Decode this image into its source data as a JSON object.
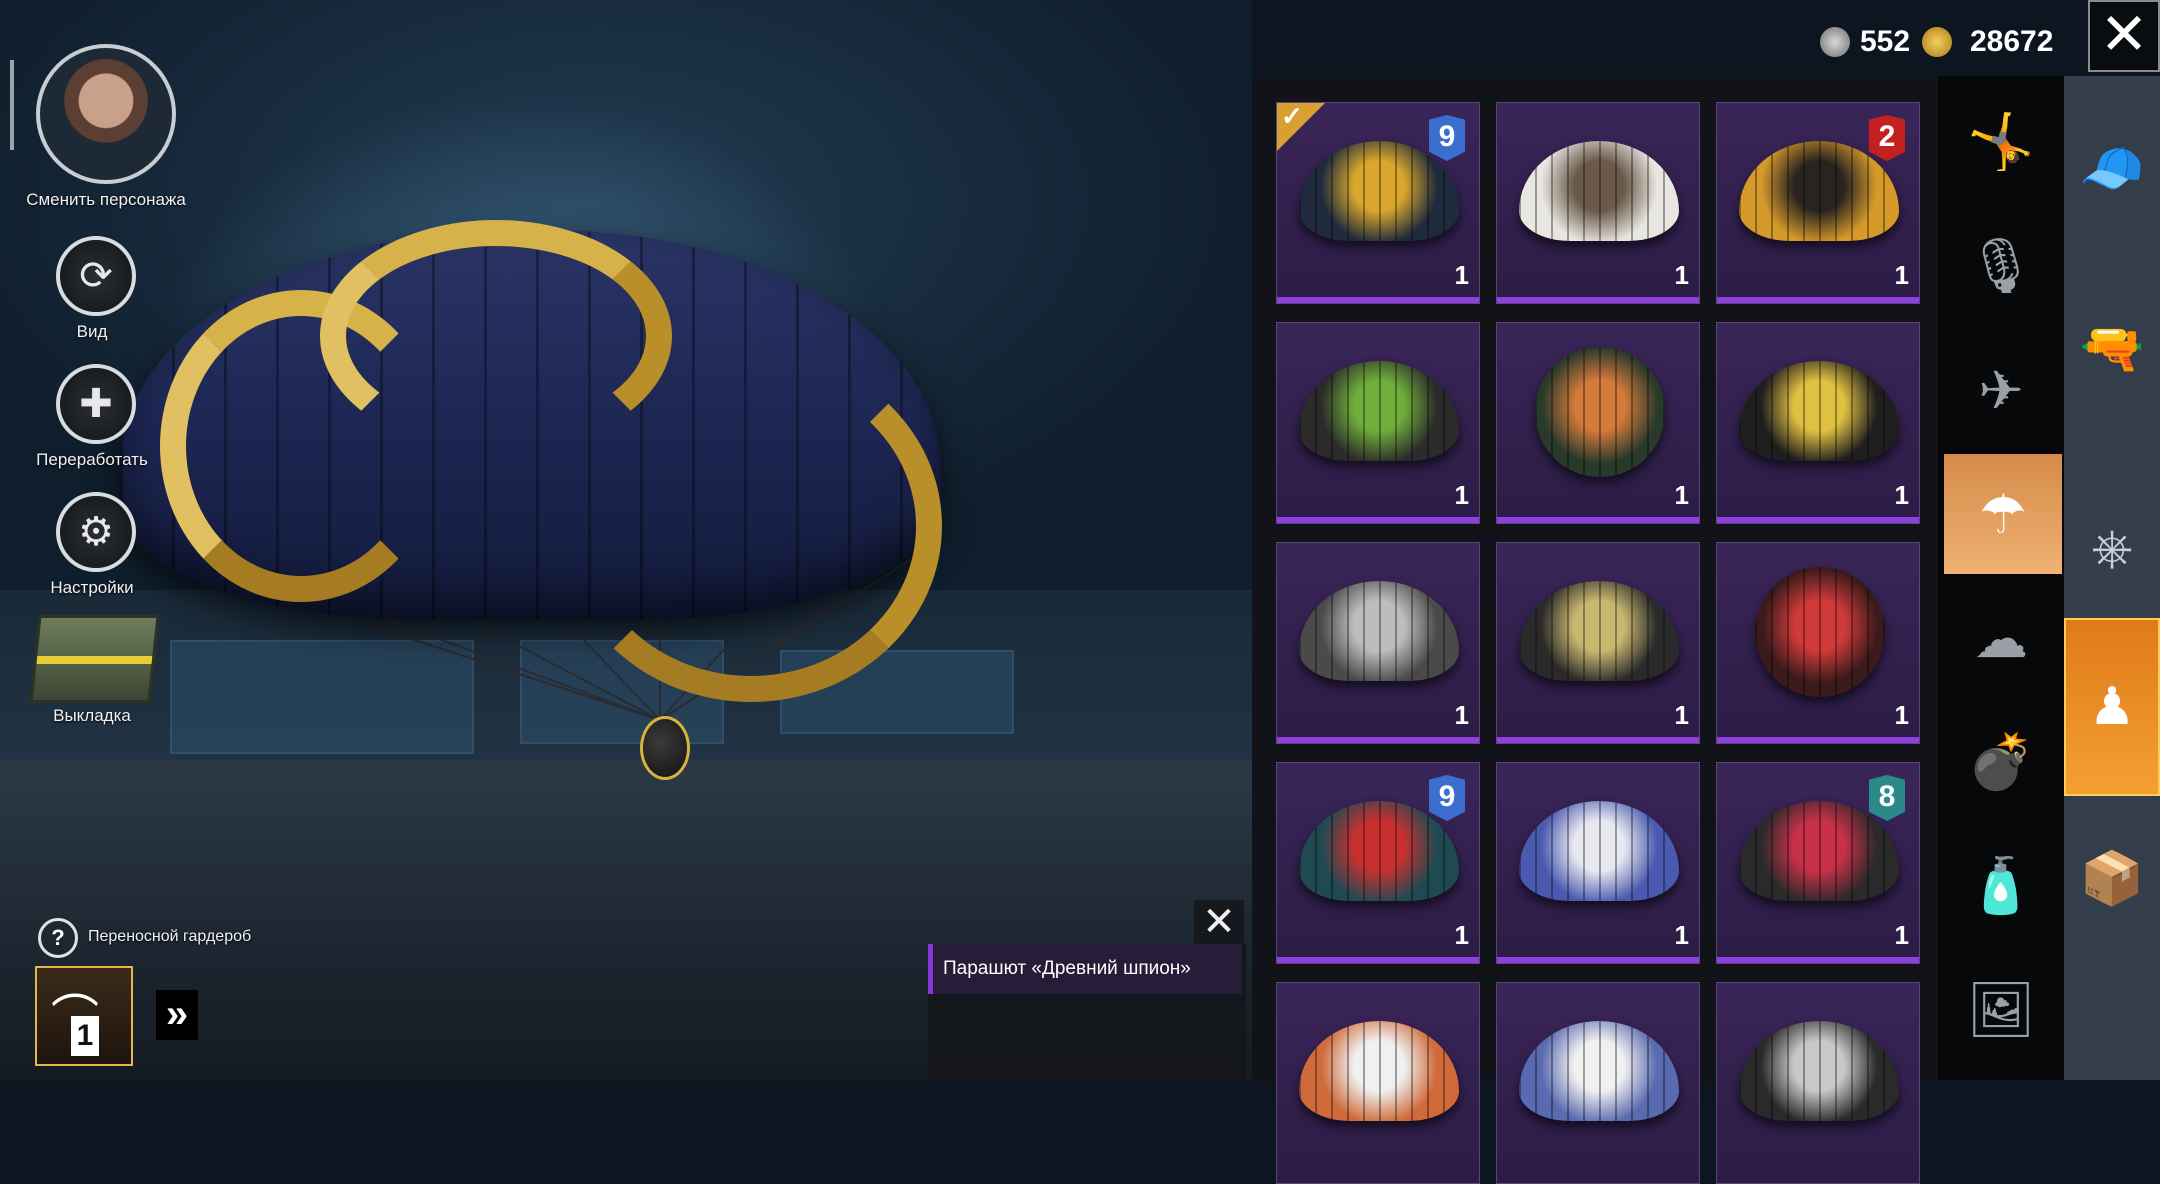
{
  "left_menu": {
    "change_character": "Сменить персонажа",
    "view": "Вид",
    "rework": "Переработать",
    "settings": "Настройки",
    "loadout": "Выкладка",
    "portable_wardrobe": "Переносной гардероб",
    "wardrobe_count": "1",
    "icons": {
      "view": "rotate-icon",
      "rework": "puzzle-icon",
      "settings": "gear-icon",
      "help": "question-icon",
      "wardrobe": "hanger-icon",
      "expand": "double-chevron-right-icon"
    }
  },
  "currency": {
    "silver_value": "552",
    "gold_value": "28672"
  },
  "item_info": {
    "title": "Парашют «Древний шпион»"
  },
  "grid": {
    "items": [
      {
        "qty": "1",
        "level": "9",
        "badge_color": "#3a6fd0",
        "selected": true,
        "colors": [
          "#1f2a3c",
          "#d9a72c"
        ]
      },
      {
        "qty": "1",
        "level": "",
        "badge_color": "",
        "selected": false,
        "colors": [
          "#e8e6e1",
          "#6b5a4a"
        ]
      },
      {
        "qty": "1",
        "level": "2",
        "badge_color": "#c42020",
        "selected": false,
        "colors": [
          "#d69a2a",
          "#2a2420"
        ]
      },
      {
        "qty": "1",
        "level": "",
        "badge_color": "",
        "selected": false,
        "colors": [
          "#2b2b2b",
          "#6fae3a"
        ]
      },
      {
        "qty": "1",
        "level": "",
        "badge_color": "",
        "selected": false,
        "colors": [
          "#2a3a2a",
          "#d47a3a"
        ]
      },
      {
        "qty": "1",
        "level": "",
        "badge_color": "",
        "selected": false,
        "colors": [
          "#1e1e1e",
          "#e0c040"
        ]
      },
      {
        "qty": "1",
        "level": "",
        "badge_color": "",
        "selected": false,
        "colors": [
          "#4a4a4a",
          "#bdbdbd"
        ]
      },
      {
        "qty": "1",
        "level": "",
        "badge_color": "",
        "selected": false,
        "colors": [
          "#2a2a2a",
          "#c9b870"
        ]
      },
      {
        "qty": "1",
        "level": "",
        "badge_color": "",
        "selected": false,
        "colors": [
          "#3a1a1a",
          "#d03a3a"
        ]
      },
      {
        "qty": "1",
        "level": "9",
        "badge_color": "#3a6fd0",
        "selected": false,
        "colors": [
          "#1f4a52",
          "#c83030"
        ]
      },
      {
        "qty": "1",
        "level": "",
        "badge_color": "",
        "selected": false,
        "colors": [
          "#4a5ab0",
          "#e8e8f0"
        ]
      },
      {
        "qty": "1",
        "level": "8",
        "badge_color": "#2a8a8a",
        "selected": false,
        "colors": [
          "#2a2a2a",
          "#c83048"
        ]
      },
      {
        "qty": "",
        "level": "",
        "badge_color": "",
        "selected": false,
        "colors": [
          "#d06a3a",
          "#f0f0f0"
        ]
      },
      {
        "qty": "",
        "level": "",
        "badge_color": "",
        "selected": false,
        "colors": [
          "#5a6ab0",
          "#f0f0f0"
        ]
      },
      {
        "qty": "",
        "level": "",
        "badge_color": "",
        "selected": false,
        "colors": [
          "#2a2a2a",
          "#c8c8c8"
        ]
      }
    ]
  },
  "categories": [
    {
      "icon": "emote-icon",
      "active": false,
      "glyph": "🤸"
    },
    {
      "icon": "microphone-icon",
      "active": false,
      "glyph": "🎙"
    },
    {
      "icon": "plane-icon",
      "active": false,
      "glyph": "✈"
    },
    {
      "icon": "parachute-icon",
      "active": true,
      "glyph": "☂"
    },
    {
      "icon": "smoke-icon",
      "active": false,
      "glyph": "☁"
    },
    {
      "icon": "grenade-icon",
      "active": false,
      "glyph": "💣"
    },
    {
      "icon": "spray-icon",
      "active": false,
      "glyph": "🧴"
    },
    {
      "icon": "gallery-icon",
      "active": false,
      "glyph": "🖼"
    }
  ],
  "types": [
    {
      "icon": "outfit-icon",
      "active": false,
      "glyph": "🧢"
    },
    {
      "icon": "pistol-icon",
      "active": false,
      "glyph": "🔫"
    },
    {
      "icon": "steering-wheel-icon",
      "active": false,
      "glyph": "⎈"
    },
    {
      "icon": "emote-figure-icon",
      "active": true,
      "glyph": "♟"
    },
    {
      "icon": "crate-icon",
      "active": false,
      "glyph": "📦"
    }
  ],
  "colors": {
    "accent_purple": "#8d3fe0",
    "accent_orange": "#f0a030"
  }
}
